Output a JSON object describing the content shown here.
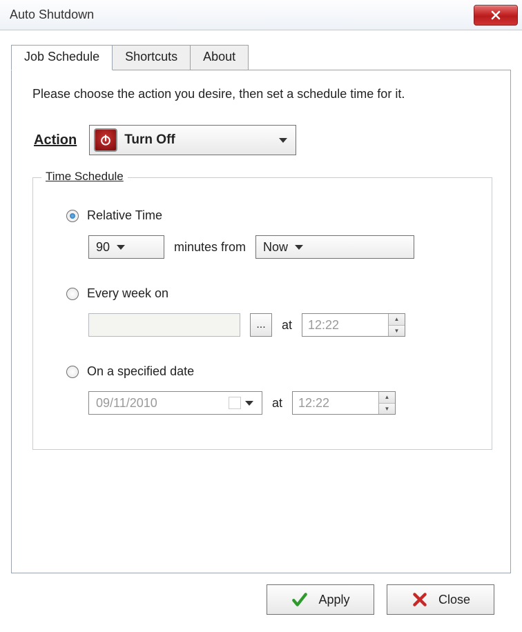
{
  "window": {
    "title": "Auto Shutdown"
  },
  "tabs": {
    "job_schedule": "Job Schedule",
    "shortcuts": "Shortcuts",
    "about": "About"
  },
  "intro": "Please choose the action you desire, then set a schedule time for it.",
  "action": {
    "label": "Action",
    "selected": "Turn Off"
  },
  "schedule": {
    "legend": "Time Schedule",
    "relative": {
      "label": "Relative Time",
      "minutes_value": "90",
      "minutes_from_text": "minutes from",
      "from_selected": "Now"
    },
    "weekly": {
      "label": "Every week on",
      "days_value": "",
      "at_text": "at",
      "time_value": "12:22"
    },
    "specified": {
      "label": "On a specified date",
      "date_value": "09/11/2010",
      "at_text": "at",
      "time_value": "12:22"
    }
  },
  "buttons": {
    "apply": "Apply",
    "close": "Close",
    "ellipsis": "..."
  }
}
